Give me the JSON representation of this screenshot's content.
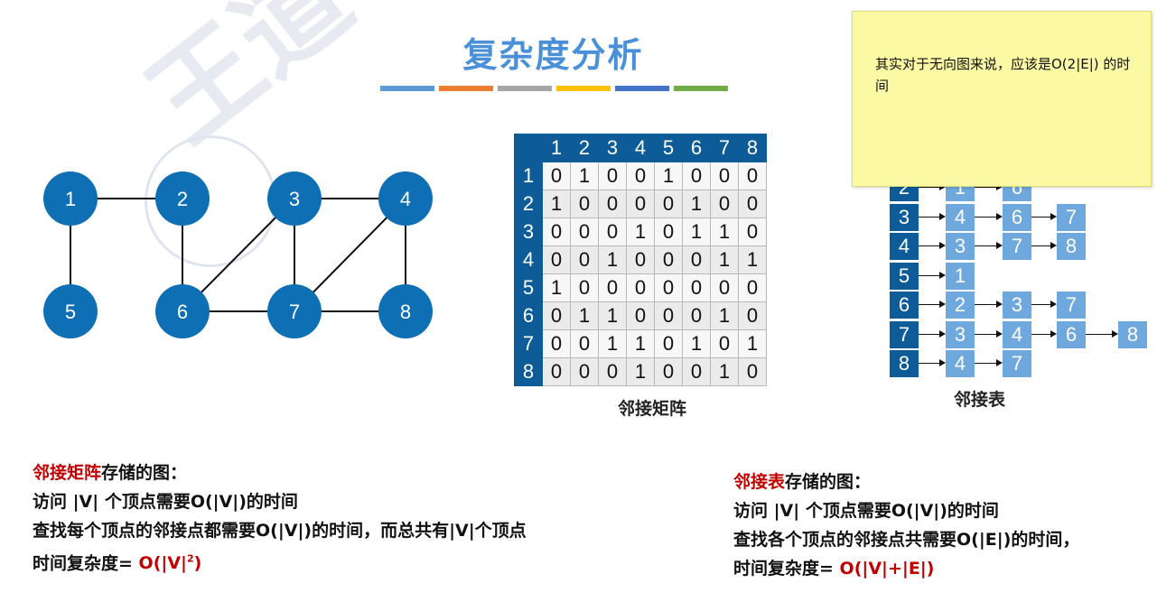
{
  "title": "复杂度分析",
  "color_bars": [
    "#5b9bd5",
    "#ed7d31",
    "#a5a5a5",
    "#ffc000",
    "#4472c4",
    "#70ad47"
  ],
  "graph": {
    "node_color": "#0f6fb5",
    "nodes": [
      "1",
      "2",
      "3",
      "4",
      "5",
      "6",
      "7",
      "8"
    ],
    "edges": [
      [
        "1",
        "2"
      ],
      [
        "1",
        "5"
      ],
      [
        "2",
        "6"
      ],
      [
        "3",
        "4"
      ],
      [
        "3",
        "6"
      ],
      [
        "3",
        "7"
      ],
      [
        "4",
        "7"
      ],
      [
        "4",
        "8"
      ],
      [
        "6",
        "7"
      ],
      [
        "7",
        "8"
      ]
    ]
  },
  "matrix": {
    "headers": [
      "1",
      "2",
      "3",
      "4",
      "5",
      "6",
      "7",
      "8"
    ],
    "rows": [
      [
        "0",
        "1",
        "0",
        "0",
        "1",
        "0",
        "0",
        "0"
      ],
      [
        "1",
        "0",
        "0",
        "0",
        "0",
        "1",
        "0",
        "0"
      ],
      [
        "0",
        "0",
        "0",
        "1",
        "0",
        "1",
        "1",
        "0"
      ],
      [
        "0",
        "0",
        "1",
        "0",
        "0",
        "0",
        "1",
        "1"
      ],
      [
        "1",
        "0",
        "0",
        "0",
        "0",
        "0",
        "0",
        "0"
      ],
      [
        "0",
        "1",
        "1",
        "0",
        "0",
        "0",
        "1",
        "0"
      ],
      [
        "0",
        "0",
        "1",
        "1",
        "0",
        "1",
        "0",
        "1"
      ],
      [
        "0",
        "0",
        "0",
        "1",
        "0",
        "0",
        "1",
        "0"
      ]
    ],
    "label": "邻接矩阵"
  },
  "adj_list": {
    "label": "邻接表",
    "rows": [
      {
        "head": "2",
        "items": [
          "1",
          "6"
        ]
      },
      {
        "head": "3",
        "items": [
          "4",
          "6",
          "7"
        ]
      },
      {
        "head": "4",
        "items": [
          "3",
          "7",
          "8"
        ]
      },
      {
        "head": "5",
        "items": [
          "1"
        ]
      },
      {
        "head": "6",
        "items": [
          "2",
          "3",
          "7"
        ]
      },
      {
        "head": "7",
        "items": [
          "3",
          "4",
          "6",
          "8"
        ]
      },
      {
        "head": "8",
        "items": [
          "4",
          "7"
        ]
      }
    ]
  },
  "note": "其实对于无向图来说，应该是O(2|E|) 的时间",
  "left_text": {
    "line1_red": "邻接矩阵",
    "line1_rest": "存储的图：",
    "line2": "访问 |V| 个顶点需要O(|V|)的时间",
    "line3": "查找每个顶点的邻接点都需要O(|V|)的时间，而总共有|V|个顶点",
    "line4_pre": "时间复杂度= ",
    "line4_red": "O(|V|",
    "line4_sup": "2",
    "line4_red_end": ")"
  },
  "right_text": {
    "line1_red": "邻接表",
    "line1_rest": "存储的图：",
    "line2": "访问 |V| 个顶点需要O(|V|)的时间",
    "line3": "查找各个顶点的邻接点共需要O(|E|)的时间，",
    "line4_pre": "时间复杂度= ",
    "line4_red": "O(|V|+|E|)"
  }
}
